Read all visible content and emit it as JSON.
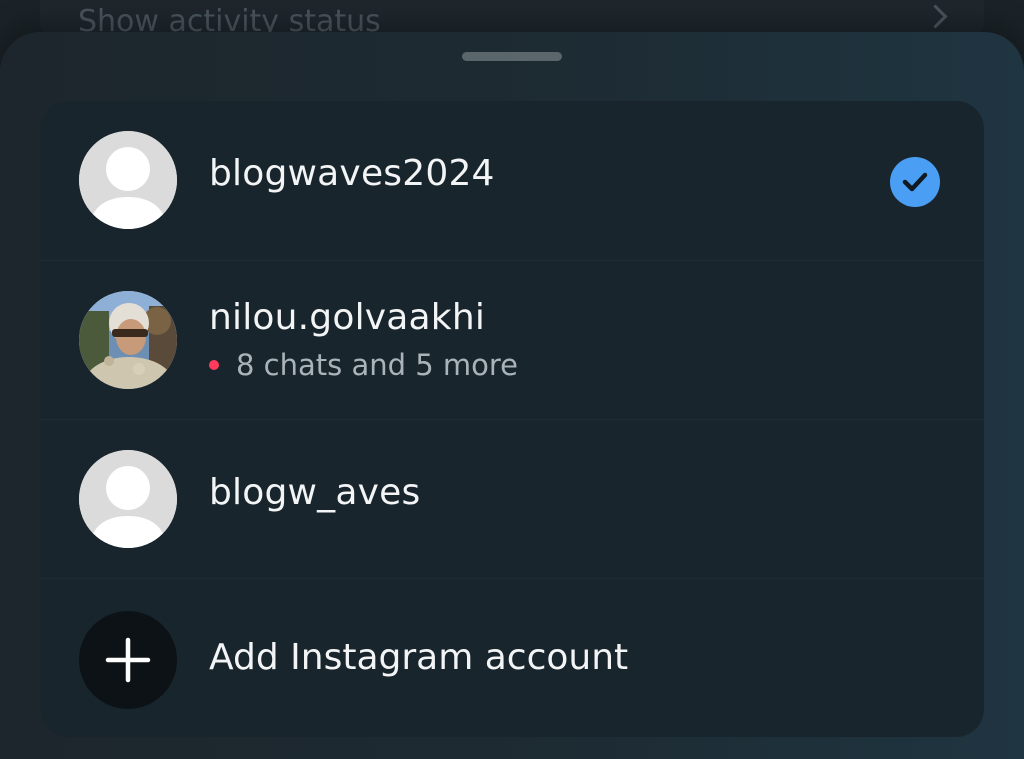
{
  "background": {
    "row_label": "Show activity status"
  },
  "accounts": [
    {
      "username": "blogwaves2024",
      "avatar": "default-avatar",
      "selected": true,
      "status_icon": "checkmark-icon"
    },
    {
      "username": "nilou.golvaakhi",
      "avatar": "photo-avatar",
      "subtitle": "8 chats and 5 more",
      "notification_dot_color": "#ff3b5c"
    },
    {
      "username": "blogw_aves",
      "avatar": "default-avatar"
    }
  ],
  "add_account": {
    "label": "Add Instagram account",
    "icon": "plus-icon"
  },
  "colors": {
    "accent_check": "#4a9ff5",
    "notification_dot": "#ff3b5c"
  }
}
